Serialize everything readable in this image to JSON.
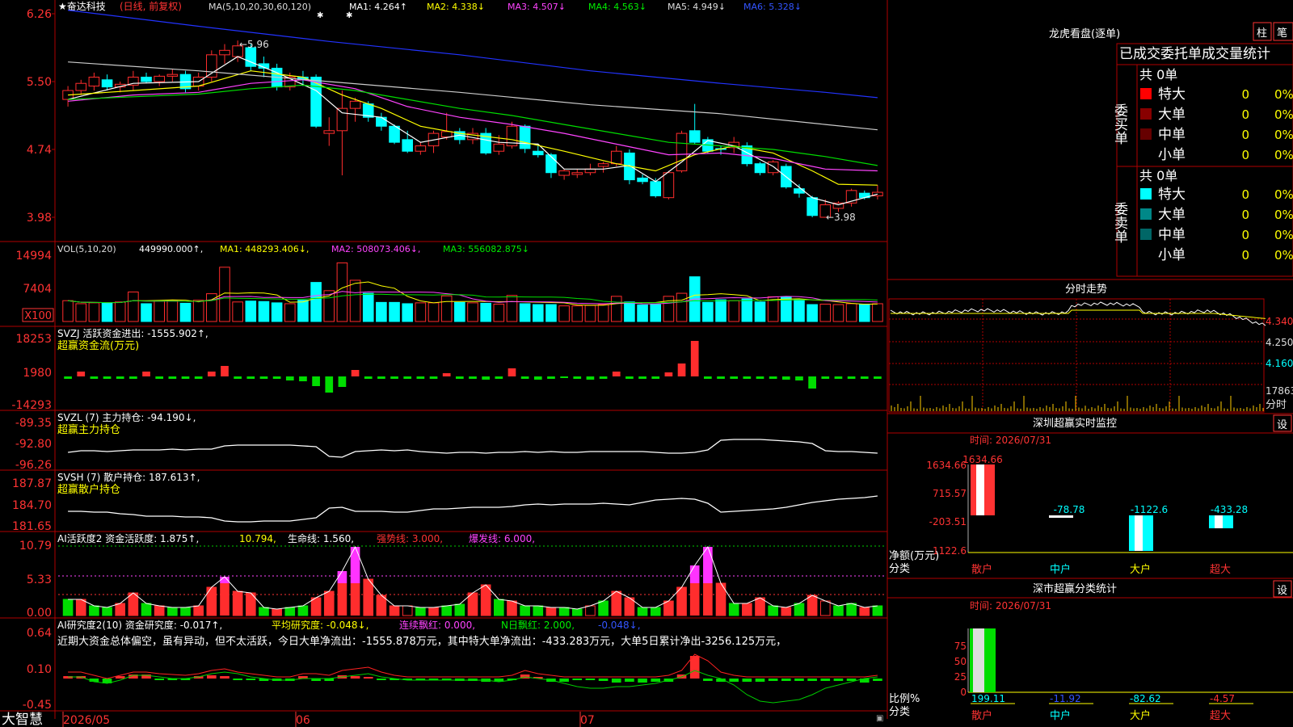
{
  "app": {
    "stock_name": "★奋达科技",
    "period_note": "(日线, 前复权)",
    "brand": "大智慧"
  },
  "colors": {
    "up": "#ff2d2d",
    "down": "#00ffff",
    "grid": "#b00000",
    "ma1": "#ffffff",
    "ma2": "#ffff00",
    "ma3": "#ff44ff",
    "ma4": "#00dd00",
    "ma5": "#cccccc",
    "ma6": "#2233ff",
    "bg": "#000000"
  },
  "main": {
    "ma_header": {
      "params": "MA(5,10,20,30,60,120)",
      "ma1": "MA1: 4.264↑",
      "ma2": "MA2: 4.338↓",
      "ma3": "MA3: 4.507↓",
      "ma4": "MA4: 4.563↓",
      "ma5": "MA5: 4.949↓",
      "ma6": "MA6: 5.328↓"
    },
    "y_ticks": [
      "6.26",
      "5.50",
      "4.74",
      "3.98"
    ],
    "y_tick_values": [
      6.26,
      5.5,
      4.74,
      3.98
    ],
    "high_label": "←5.96",
    "low_label": "←3.98",
    "x_labels": [
      "2026/05",
      "06",
      "07"
    ]
  },
  "chart_data": [
    {
      "type": "candlestick",
      "title": "",
      "ylim": [
        3.78,
        6.35
      ],
      "candles": [
        {
          "o": 5.3,
          "h": 5.45,
          "l": 5.22,
          "c": 5.4
        },
        {
          "o": 5.4,
          "h": 5.52,
          "l": 5.35,
          "c": 5.48
        },
        {
          "o": 5.45,
          "h": 5.6,
          "l": 5.4,
          "c": 5.55
        },
        {
          "o": 5.52,
          "h": 5.58,
          "l": 5.4,
          "c": 5.44
        },
        {
          "o": 5.44,
          "h": 5.5,
          "l": 5.38,
          "c": 5.47
        },
        {
          "o": 5.46,
          "h": 5.62,
          "l": 5.4,
          "c": 5.55
        },
        {
          "o": 5.55,
          "h": 5.6,
          "l": 5.48,
          "c": 5.5
        },
        {
          "o": 5.5,
          "h": 5.58,
          "l": 5.45,
          "c": 5.56
        },
        {
          "o": 5.56,
          "h": 5.64,
          "l": 5.5,
          "c": 5.58
        },
        {
          "o": 5.58,
          "h": 5.62,
          "l": 5.38,
          "c": 5.42
        },
        {
          "o": 5.45,
          "h": 5.6,
          "l": 5.4,
          "c": 5.55
        },
        {
          "o": 5.55,
          "h": 5.85,
          "l": 5.5,
          "c": 5.8
        },
        {
          "o": 5.8,
          "h": 5.92,
          "l": 5.7,
          "c": 5.85
        },
        {
          "o": 5.78,
          "h": 5.96,
          "l": 5.72,
          "c": 5.9
        },
        {
          "o": 5.88,
          "h": 5.92,
          "l": 5.62,
          "c": 5.67
        },
        {
          "o": 5.7,
          "h": 5.78,
          "l": 5.55,
          "c": 5.65
        },
        {
          "o": 5.65,
          "h": 5.7,
          "l": 5.4,
          "c": 5.44
        },
        {
          "o": 5.44,
          "h": 5.6,
          "l": 5.4,
          "c": 5.55
        },
        {
          "o": 5.55,
          "h": 5.62,
          "l": 5.45,
          "c": 5.52
        },
        {
          "o": 5.55,
          "h": 5.58,
          "l": 4.98,
          "c": 5.0
        },
        {
          "o": 4.92,
          "h": 5.1,
          "l": 4.78,
          "c": 4.95
        },
        {
          "o": 4.95,
          "h": 5.4,
          "l": 4.45,
          "c": 5.2
        },
        {
          "o": 5.2,
          "h": 5.32,
          "l": 5.05,
          "c": 5.28
        },
        {
          "o": 5.25,
          "h": 5.28,
          "l": 5.05,
          "c": 5.1
        },
        {
          "o": 5.1,
          "h": 5.15,
          "l": 4.95,
          "c": 5.0
        },
        {
          "o": 5.0,
          "h": 5.02,
          "l": 4.8,
          "c": 4.82
        },
        {
          "o": 4.85,
          "h": 4.95,
          "l": 4.7,
          "c": 4.72
        },
        {
          "o": 4.72,
          "h": 4.82,
          "l": 4.68,
          "c": 4.78
        },
        {
          "o": 4.78,
          "h": 4.95,
          "l": 4.7,
          "c": 4.92
        },
        {
          "o": 4.88,
          "h": 5.15,
          "l": 4.85,
          "c": 4.94
        },
        {
          "o": 4.94,
          "h": 4.98,
          "l": 4.8,
          "c": 4.85
        },
        {
          "o": 4.85,
          "h": 4.98,
          "l": 4.8,
          "c": 4.92
        },
        {
          "o": 4.92,
          "h": 4.98,
          "l": 4.68,
          "c": 4.7
        },
        {
          "o": 4.72,
          "h": 4.9,
          "l": 4.68,
          "c": 4.8
        },
        {
          "o": 4.78,
          "h": 5.05,
          "l": 4.75,
          "c": 5.0
        },
        {
          "o": 5.0,
          "h": 5.02,
          "l": 4.7,
          "c": 4.75
        },
        {
          "o": 4.72,
          "h": 4.8,
          "l": 4.65,
          "c": 4.68
        },
        {
          "o": 4.68,
          "h": 4.7,
          "l": 4.42,
          "c": 4.48
        },
        {
          "o": 4.45,
          "h": 4.52,
          "l": 4.4,
          "c": 4.5
        },
        {
          "o": 4.46,
          "h": 4.52,
          "l": 4.42,
          "c": 4.48
        },
        {
          "o": 4.48,
          "h": 4.58,
          "l": 4.45,
          "c": 4.52
        },
        {
          "o": 4.55,
          "h": 4.6,
          "l": 4.48,
          "c": 4.58
        },
        {
          "o": 4.58,
          "h": 4.78,
          "l": 4.55,
          "c": 4.72
        },
        {
          "o": 4.7,
          "h": 4.74,
          "l": 4.35,
          "c": 4.4
        },
        {
          "o": 4.42,
          "h": 4.46,
          "l": 4.35,
          "c": 4.38
        },
        {
          "o": 4.38,
          "h": 4.42,
          "l": 4.2,
          "c": 4.22
        },
        {
          "o": 4.2,
          "h": 4.5,
          "l": 4.18,
          "c": 4.48
        },
        {
          "o": 4.5,
          "h": 4.95,
          "l": 4.48,
          "c": 4.92
        },
        {
          "o": 4.95,
          "h": 5.25,
          "l": 4.8,
          "c": 4.82
        },
        {
          "o": 4.85,
          "h": 4.88,
          "l": 4.7,
          "c": 4.72
        },
        {
          "o": 4.75,
          "h": 4.78,
          "l": 4.68,
          "c": 4.74
        },
        {
          "o": 4.76,
          "h": 4.88,
          "l": 4.7,
          "c": 4.82
        },
        {
          "o": 4.78,
          "h": 4.82,
          "l": 4.55,
          "c": 4.58
        },
        {
          "o": 4.58,
          "h": 4.6,
          "l": 4.45,
          "c": 4.48
        },
        {
          "o": 4.48,
          "h": 4.62,
          "l": 4.45,
          "c": 4.6
        },
        {
          "o": 4.55,
          "h": 4.58,
          "l": 4.3,
          "c": 4.32
        },
        {
          "o": 4.3,
          "h": 4.35,
          "l": 4.2,
          "c": 4.25
        },
        {
          "o": 4.2,
          "h": 4.22,
          "l": 3.98,
          "c": 4.0
        },
        {
          "o": 3.98,
          "h": 4.18,
          "l": 3.98,
          "c": 4.12
        },
        {
          "o": 4.08,
          "h": 4.16,
          "l": 4.04,
          "c": 4.14
        },
        {
          "o": 4.14,
          "h": 4.3,
          "l": 4.1,
          "c": 4.28
        },
        {
          "o": 4.25,
          "h": 4.28,
          "l": 4.18,
          "c": 4.2
        },
        {
          "o": 4.22,
          "h": 4.34,
          "l": 4.18,
          "c": 4.26
        }
      ],
      "ma_curves": [
        {
          "name": "MA1",
          "points": [
            [
              0,
              5.3
            ],
            [
              5,
              5.48
            ],
            [
              10,
              5.5
            ],
            [
              13,
              5.78
            ],
            [
              16,
              5.6
            ],
            [
              19,
              5.4
            ],
            [
              21,
              5.15
            ],
            [
              24,
              5.1
            ],
            [
              27,
              4.82
            ],
            [
              30,
              4.9
            ],
            [
              33,
              4.82
            ],
            [
              36,
              4.8
            ],
            [
              38,
              4.52
            ],
            [
              41,
              4.52
            ],
            [
              43,
              4.56
            ],
            [
              45,
              4.38
            ],
            [
              47,
              4.6
            ],
            [
              49,
              4.84
            ],
            [
              51,
              4.78
            ],
            [
              54,
              4.55
            ],
            [
              57,
              4.2
            ],
            [
              59,
              4.12
            ],
            [
              62,
              4.24
            ]
          ]
        },
        {
          "name": "MA2",
          "points": [
            [
              0,
              5.35
            ],
            [
              5,
              5.4
            ],
            [
              10,
              5.45
            ],
            [
              14,
              5.62
            ],
            [
              18,
              5.55
            ],
            [
              21,
              5.35
            ],
            [
              24,
              5.2
            ],
            [
              27,
              5.0
            ],
            [
              30,
              4.92
            ],
            [
              34,
              4.85
            ],
            [
              38,
              4.72
            ],
            [
              42,
              4.58
            ],
            [
              45,
              4.5
            ],
            [
              48,
              4.68
            ],
            [
              51,
              4.78
            ],
            [
              54,
              4.7
            ],
            [
              57,
              4.5
            ],
            [
              59,
              4.35
            ],
            [
              62,
              4.34
            ]
          ]
        },
        {
          "name": "MA3",
          "points": [
            [
              0,
              5.28
            ],
            [
              5,
              5.35
            ],
            [
              10,
              5.38
            ],
            [
              14,
              5.48
            ],
            [
              18,
              5.52
            ],
            [
              22,
              5.42
            ],
            [
              26,
              5.22
            ],
            [
              30,
              5.1
            ],
            [
              34,
              5.02
            ],
            [
              38,
              4.92
            ],
            [
              42,
              4.8
            ],
            [
              46,
              4.68
            ],
            [
              50,
              4.7
            ],
            [
              54,
              4.64
            ],
            [
              58,
              4.52
            ],
            [
              62,
              4.5
            ]
          ]
        },
        {
          "name": "MA4",
          "points": [
            [
              0,
              5.3
            ],
            [
              5,
              5.33
            ],
            [
              10,
              5.36
            ],
            [
              14,
              5.42
            ],
            [
              18,
              5.46
            ],
            [
              22,
              5.4
            ],
            [
              26,
              5.3
            ],
            [
              30,
              5.2
            ],
            [
              34,
              5.12
            ],
            [
              38,
              5.02
            ],
            [
              42,
              4.92
            ],
            [
              46,
              4.82
            ],
            [
              50,
              4.78
            ],
            [
              54,
              4.74
            ],
            [
              58,
              4.66
            ],
            [
              62,
              4.56
            ]
          ]
        },
        {
          "name": "MA5",
          "points": [
            [
              0,
              5.72
            ],
            [
              10,
              5.62
            ],
            [
              20,
              5.5
            ],
            [
              30,
              5.38
            ],
            [
              40,
              5.24
            ],
            [
              50,
              5.14
            ],
            [
              58,
              5.02
            ],
            [
              62,
              4.96
            ]
          ]
        },
        {
          "name": "MA6",
          "points": [
            [
              0,
              6.3
            ],
            [
              10,
              6.12
            ],
            [
              20,
              5.95
            ],
            [
              30,
              5.8
            ],
            [
              40,
              5.62
            ],
            [
              50,
              5.48
            ],
            [
              58,
              5.38
            ],
            [
              62,
              5.32
            ]
          ]
        }
      ]
    },
    {
      "type": "bar",
      "title": "",
      "values": [
        4800,
        4100,
        4300,
        4200,
        4500,
        6800,
        4100,
        4700,
        4800,
        4200,
        4900,
        6400,
        12500,
        4500,
        4700,
        4600,
        4300,
        4100,
        4900,
        9000,
        7100,
        13500,
        9500,
        6500,
        4400,
        4400,
        4100,
        4300,
        4300,
        5900,
        4400,
        4300,
        4200,
        4000,
        6000,
        4100,
        3900,
        3900,
        3600,
        3600,
        3700,
        3900,
        5800,
        4500,
        3800,
        3900,
        5800,
        6500,
        10300,
        4400,
        5000,
        4800,
        5200,
        4500,
        5700,
        5700,
        5000,
        3900,
        4000,
        3900,
        4100,
        4000,
        4100
      ],
      "ylim": [
        0,
        16000
      ]
    }
  ],
  "vol": {
    "header_label": "VOL(5,10,20)",
    "header_value": "449990.000↑,",
    "ma1": "MA1: 448293.406↓,",
    "ma2": "MA2: 508073.406↓,",
    "ma3": "MA3: 556082.875↓",
    "y_ticks": [
      "14994",
      "7404",
      "X100"
    ]
  },
  "svzj": {
    "header": "SVZJ  活跃资金进出: -1555.902↑,",
    "subtitle": "超赢资金流(万元)",
    "y_ticks": [
      "18253",
      "1980",
      "-14293"
    ]
  },
  "svzl": {
    "header": "SVZL (7) 主力持仓: -94.190↓,",
    "subtitle": "超赢主力持仓",
    "y_ticks": [
      "-89.35",
      "-92.80",
      "-96.26"
    ]
  },
  "svsh": {
    "header": "SVSH (7) 散户持仓: 187.613↑,",
    "subtitle": "超赢散户持仓",
    "y_ticks": [
      "187.87",
      "184.70",
      "181.65"
    ]
  },
  "ai_active": {
    "header_prefix": "AI活跃度2 资金活跃度: 1.875↑,",
    "header_val2": "10.794,",
    "header_life": "生命线: 1.560,",
    "header_strong": "强势线: 3.000,",
    "header_burst": "爆发线: 6.000,",
    "y_ticks": [
      "10.79",
      "5.33",
      "0.00"
    ]
  },
  "ai_research": {
    "header_prefix": "AI研究度2(10) 资金研究度: -0.017↑,",
    "header_avg": "平均研究度: -0.048↓,",
    "header_cont": "连续飘红: 0.000,",
    "header_n": "N日飘红: 2.000,",
    "header_tail": "-0.048↓,",
    "comment": "近期大资金总体偏空，虽有异动，但不太活跃，今日大单净流出：-1555.878万元，其中特大单净流出：-433.283万元，大单5日累计净出-3256.125万元，",
    "y_ticks": [
      "0.64",
      "0.10",
      "-0.45"
    ]
  },
  "right": {
    "longhu_title": "龙虎看盘(逐单)",
    "btn_zhu": "柱",
    "btn_bi": "笔",
    "stats_title": "已成交委托单成交量统计",
    "buy_label": "委买单",
    "sell_label": "委卖单",
    "buy_total": "共 0单",
    "sell_total": "共 0单",
    "buy_rows": [
      {
        "label": "特大",
        "count": "0",
        "pct": "0%",
        "color": "#ff0000"
      },
      {
        "label": "大单",
        "count": "0",
        "pct": "0%",
        "color": "#880000"
      },
      {
        "label": "中单",
        "count": "0",
        "pct": "0%",
        "color": "#660000"
      },
      {
        "label": "小单",
        "count": "0",
        "pct": "0%",
        "color": "#000000"
      }
    ],
    "sell_rows": [
      {
        "label": "特大",
        "count": "0",
        "pct": "0%",
        "color": "#00ffff"
      },
      {
        "label": "大单",
        "count": "0",
        "pct": "0%",
        "color": "#008888"
      },
      {
        "label": "中单",
        "count": "0",
        "pct": "0%",
        "color": "#006666"
      },
      {
        "label": "小单",
        "count": "0",
        "pct": "0%",
        "color": "#000000"
      }
    ],
    "fenshi_title": "分时走势",
    "fenshi_ticks": [
      "4.340",
      "4.250",
      "4.160"
    ],
    "fenshi_vol_label": "17863",
    "fenshi_vol_unit": "分时",
    "monitor_title": "深圳超赢实时监控",
    "monitor_btn": "设",
    "monitor_date": "时间: 2026/07/31",
    "monitor_ticks": [
      "1634.66",
      "715.57",
      "-203.51",
      "-1122.6"
    ],
    "monitor_values": [
      "1634.66",
      "-78.78",
      "-1122.6",
      "-433.28"
    ],
    "monitor_net_label": "净额(万元)",
    "monitor_cat_label": "分类",
    "categories": [
      "散户",
      "中户",
      "大户",
      "超大"
    ],
    "classify_title": "深市超赢分类统计",
    "classify_btn": "设",
    "classify_date": "时间: 2026/07/31",
    "classify_ticks": [
      "75",
      "50",
      "25",
      "0"
    ],
    "classify_values": [
      "199.11",
      "-11.92",
      "-82.62",
      "-4.57"
    ],
    "classify_ratio_label": "比例%",
    "classify_cat_label": "分类"
  }
}
